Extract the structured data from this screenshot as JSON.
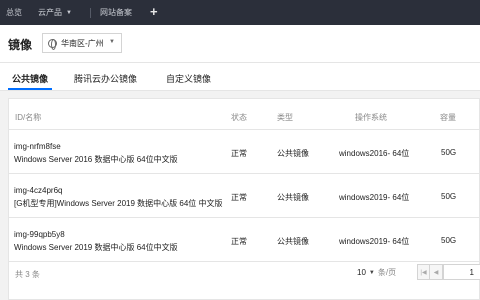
{
  "topbar": {
    "overview": "总览",
    "products": "云产品",
    "filing": "网站备案",
    "plus": "+"
  },
  "header": {
    "title": "镜像",
    "region": "华南区-广州"
  },
  "tabs": [
    {
      "label": "公共镜像",
      "active": true
    },
    {
      "label": "腾讯云办公镜像",
      "active": false
    },
    {
      "label": "自定义镜像",
      "active": false
    }
  ],
  "table": {
    "columns": [
      "ID/名称",
      "状态",
      "类型",
      "操作系统",
      "容量"
    ],
    "rows": [
      {
        "id": "img-nrfm8fse",
        "name": "Windows Server 2016 数据中心版 64位中文版",
        "status": "正常",
        "type": "公共镜像",
        "os": "windows2016- 64位",
        "capacity": "50G"
      },
      {
        "id": "img-4cz4pr6q",
        "name": "[G机型专用]Windows Server 2019 数据中心版 64位 中文版",
        "status": "正常",
        "type": "公共镜像",
        "os": "windows2019- 64位",
        "capacity": "50G"
      },
      {
        "id": "img-99qpb5y8",
        "name": "Windows Server 2019 数据中心版 64位中文版",
        "status": "正常",
        "type": "公共镜像",
        "os": "windows2019- 64位",
        "capacity": "50G"
      }
    ]
  },
  "footer": {
    "total": "共 3 条",
    "page_size": "10",
    "page_size_unit": "条/页",
    "page": "1"
  }
}
